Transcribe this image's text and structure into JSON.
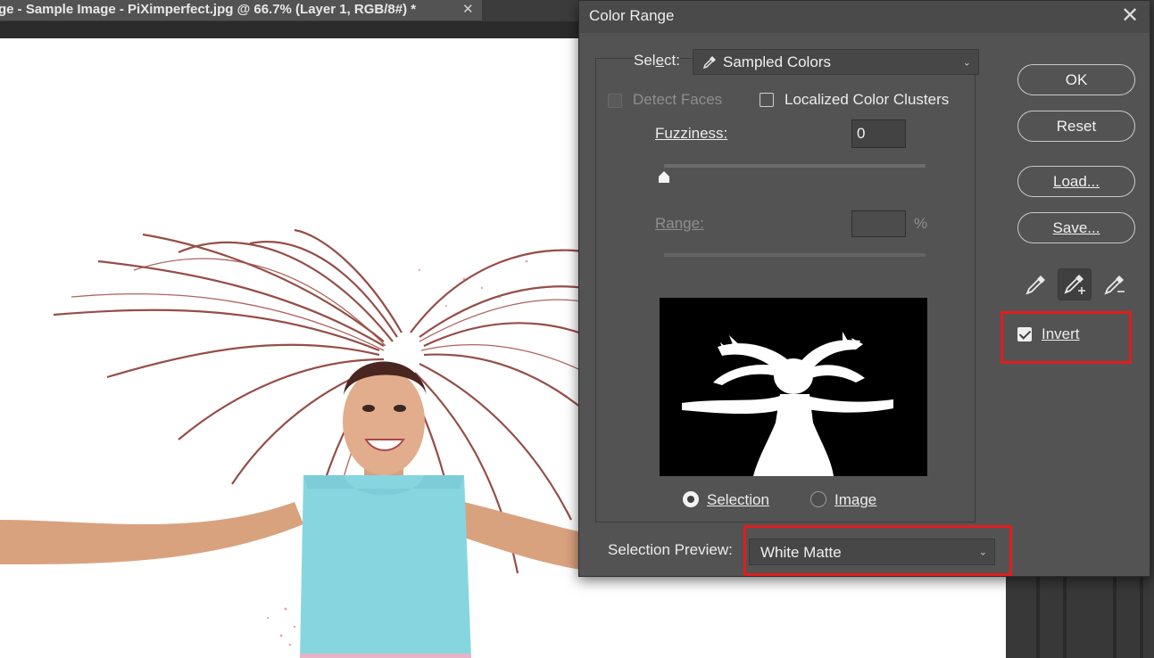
{
  "document": {
    "tab_title": "ge - Sample Image - PiXimperfect.jpg @ 66.7% (Layer 1, RGB/8#) *",
    "tab_close": "✕"
  },
  "dialog": {
    "title": "Color Range",
    "close": "✕",
    "select_label": "Select:",
    "select_label_prefix": "Sel",
    "select_label_mnemonic": "e",
    "select_label_suffix": "ct:",
    "select_value": "Sampled Colors",
    "detect_faces_label": "Detect Faces",
    "detect_faces_checked": false,
    "detect_faces_enabled": false,
    "localized_label": "Localized Color Clusters",
    "localized_checked": false,
    "fuzziness_label": "Fuzziness:",
    "fuzziness_value": "0",
    "fuzziness_level": 0,
    "range_label": "Range:",
    "range_value": "",
    "range_unit": "%",
    "preview_mode": {
      "selection_label": "Selection",
      "image_label": "Image",
      "selected": "Selection"
    },
    "selection_preview_label": "Selection Preview:",
    "selection_preview_value": "White Matte",
    "buttons": {
      "ok": "OK",
      "reset": "Reset",
      "load": "Load...",
      "save": "Save..."
    },
    "eyedroppers": [
      "eyedropper-icon",
      "add-to-sample-eyedropper-icon",
      "subtract-from-sample-eyedropper-icon"
    ],
    "active_eyedropper": "add-to-sample-eyedropper-icon",
    "invert_label": "Invert",
    "invert_checked": true
  },
  "colors": {
    "dialog_bg": "#535353",
    "highlight": "#e11d1d",
    "canvas_bg": "#ffffff"
  }
}
